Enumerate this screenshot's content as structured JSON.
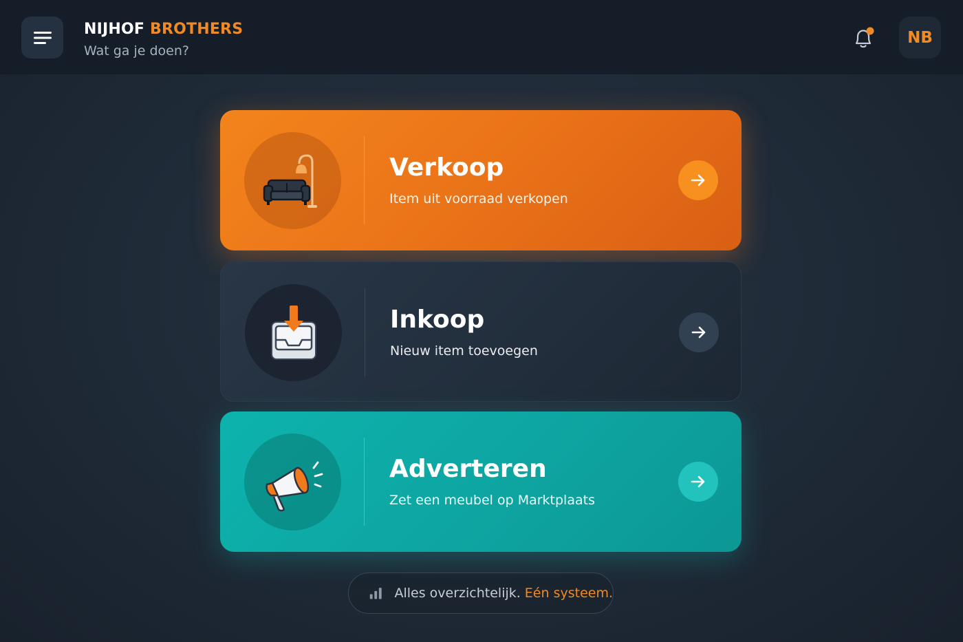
{
  "header": {
    "brand_part1": "NIJHOF",
    "brand_part2": "BROTHERS",
    "subtitle": "Wat ga je doen?",
    "avatar_initials": "NB",
    "has_notification": true,
    "menu_icon": "hamburger-icon",
    "bell_icon": "bell-icon"
  },
  "cards": [
    {
      "title": "Verkoop",
      "subtitle": "Item uit voorraad verkopen",
      "icon": "sofa-lamp-icon",
      "color": "#f07a1c"
    },
    {
      "title": "Inkoop",
      "subtitle": "Nieuw item toevoegen",
      "icon": "inbox-download-icon",
      "color": "#243140"
    },
    {
      "title": "Adverteren",
      "subtitle": "Zet een meubel op Marktplaats",
      "icon": "megaphone-icon",
      "color": "#0eaaa5"
    }
  ],
  "footer": {
    "text": "Alles overzichtelijk.",
    "accent": "Eén systeem.",
    "icon": "bar-chart-icon"
  },
  "colors": {
    "accent": "#f08a24",
    "teal": "#0eaaa5",
    "background": "#1f2a37"
  }
}
